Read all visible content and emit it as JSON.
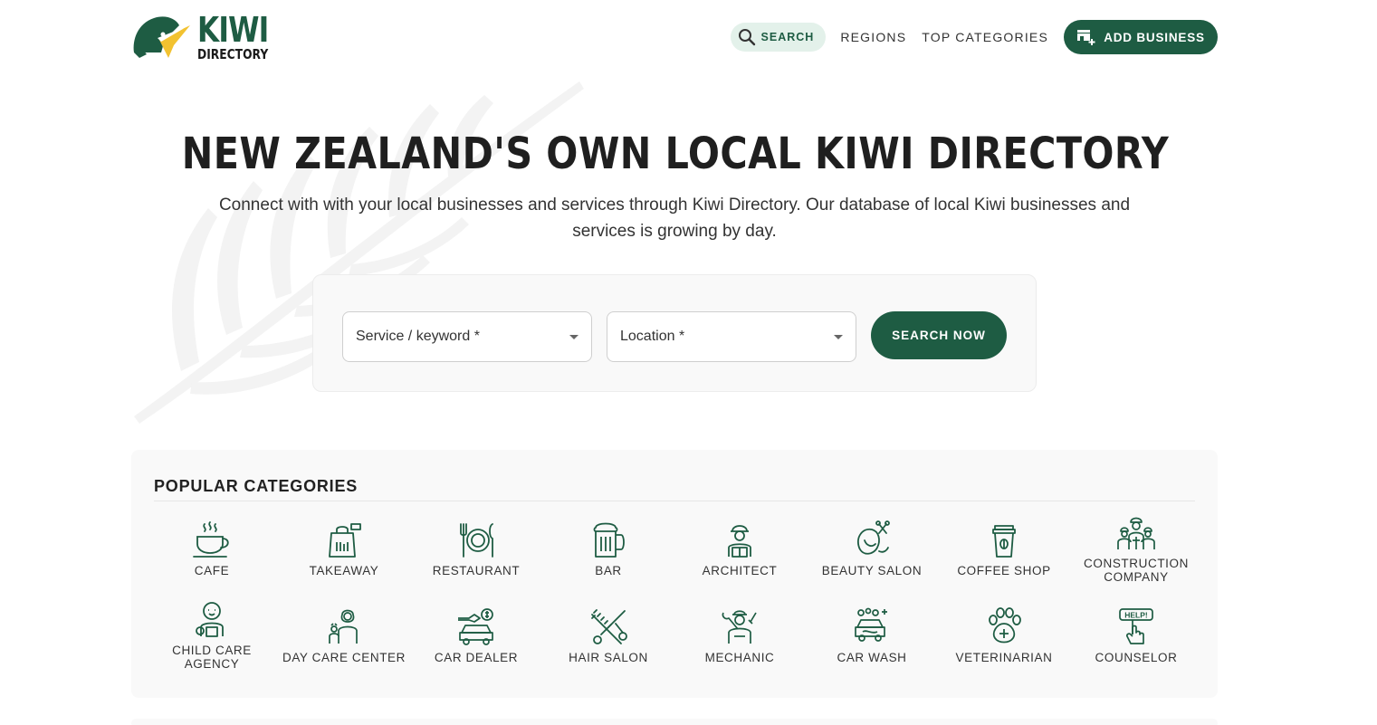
{
  "brand": {
    "name_top": "KIWI",
    "name_bottom": "DIRECTORY"
  },
  "nav": {
    "search_label": "SEARCH",
    "regions_label": "REGIONS",
    "top_categories_label": "TOP CATEGORIES",
    "add_business_label": "ADD BUSINESS"
  },
  "hero": {
    "title": "NEW ZEALAND'S OWN LOCAL KIWI DIRECTORY",
    "subtitle": "Connect with with your local businesses and services through Kiwi Directory. Our database of local Kiwi businesses and services is growing by day."
  },
  "search": {
    "service_placeholder": "Service / keyword *",
    "location_placeholder": "Location *",
    "button_label": "SEARCH NOW"
  },
  "categories": {
    "title": "POPULAR CATEGORIES",
    "items": [
      {
        "label": "CAFE",
        "icon": "cafe-icon"
      },
      {
        "label": "TAKEAWAY",
        "icon": "takeaway-icon"
      },
      {
        "label": "RESTAURANT",
        "icon": "restaurant-icon"
      },
      {
        "label": "BAR",
        "icon": "bar-icon"
      },
      {
        "label": "ARCHITECT",
        "icon": "architect-icon"
      },
      {
        "label": "BEAUTY SALON",
        "icon": "beauty-salon-icon"
      },
      {
        "label": "COFFEE SHOP",
        "icon": "coffee-shop-icon"
      },
      {
        "label": "CONSTRUCTION COMPANY",
        "icon": "construction-company-icon"
      },
      {
        "label": "CHILD CARE AGENCY",
        "icon": "child-care-icon"
      },
      {
        "label": "DAY CARE CENTER",
        "icon": "day-care-icon"
      },
      {
        "label": "CAR DEALER",
        "icon": "car-dealer-icon"
      },
      {
        "label": "HAIR SALON",
        "icon": "hair-salon-icon"
      },
      {
        "label": "MECHANIC",
        "icon": "mechanic-icon"
      },
      {
        "label": "CAR WASH",
        "icon": "car-wash-icon"
      },
      {
        "label": "VETERINARIAN",
        "icon": "veterinarian-icon"
      },
      {
        "label": "COUNSELOR",
        "icon": "counselor-icon"
      }
    ]
  },
  "icon_texts": {
    "counselor_sign": "HELP!"
  },
  "colors": {
    "brand_green": "#1e5c43",
    "kiwi_beak": "#f2c230",
    "search_pill_bg": "#e3f1ea"
  }
}
